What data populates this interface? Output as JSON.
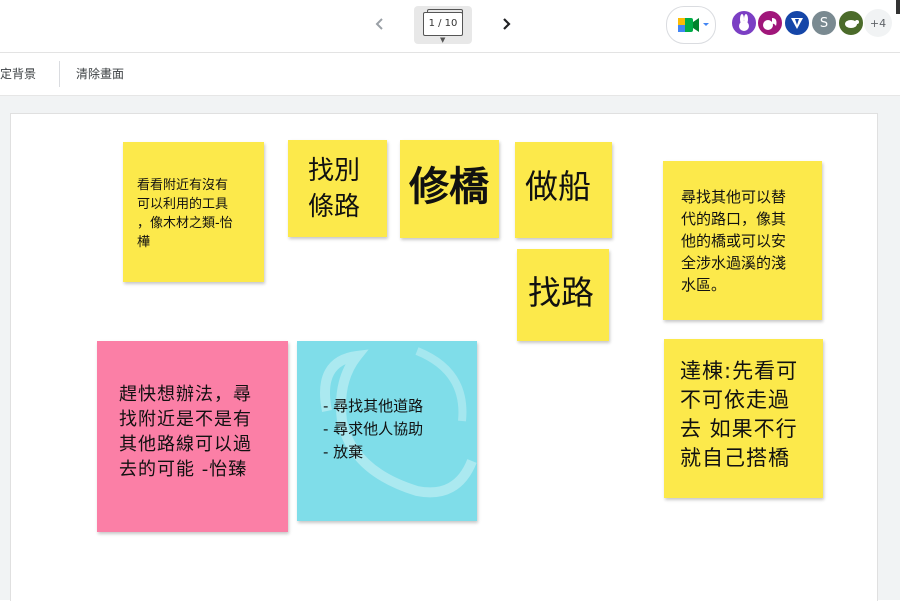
{
  "header": {
    "frame_indicator": "1 / 10",
    "more_participants": "+4",
    "participants": [
      {
        "name": "purple-rabbit-avatar",
        "initial": "",
        "color": "#7b3fc4"
      },
      {
        "name": "magenta-animal-avatar",
        "initial": "",
        "color": "#a0167a"
      },
      {
        "name": "blue-badger-avatar",
        "initial": "",
        "color": "#1546a8"
      },
      {
        "name": "s-avatar",
        "initial": "S",
        "color": "#7a8a91"
      },
      {
        "name": "green-turtle-avatar",
        "initial": "",
        "color": "#4b6b2a"
      }
    ]
  },
  "toolbar": {
    "set_background": "設定背景",
    "clear_frame": "清除畫面"
  },
  "notes": {
    "n1": "看看附近有沒有\n可以利用的工具\n，像木材之類-怡\n樺",
    "n2": "找別\n條路",
    "n3": "修橋",
    "n4": "做船",
    "n5": "找路",
    "n6": "尋找其他可以替\n代的路口，像其\n他的橋或可以安\n全涉水過溪的淺\n水區。",
    "n7": "趕快想辦法，尋\n找附近是不是有\n其他路線可以過\n去的可能 -怡臻",
    "n8": "- 尋找其他道路\n- 尋求他人協助\n- 放棄",
    "n9": "達棟:先看可\n不可依走過\n去 如果不行\n就自己搭橋"
  },
  "colors": {
    "note_yellow": "#fce94b",
    "note_pink": "#fb7fa6",
    "note_cyan": "#7fdde9",
    "meet_green": "#00ac47",
    "meet_blue": "#4285f4",
    "meet_yellow": "#fbbc04"
  }
}
